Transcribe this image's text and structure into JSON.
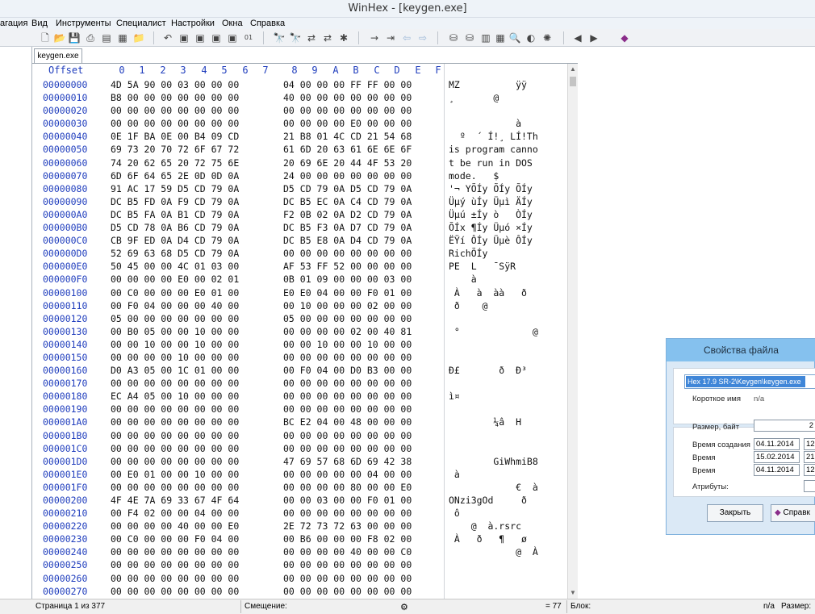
{
  "window": {
    "title": "WinHex - [keygen.exe]"
  },
  "menu": [
    "агация",
    "Вид",
    "Инструменты",
    "Специалист",
    "Настройки",
    "Окна",
    "Справка"
  ],
  "toolbar_icons": [
    "new-file-icon",
    "open-icon",
    "save-icon",
    "print-icon",
    "properties-icon",
    "copy-icon",
    "open-folder-icon",
    "undo-icon",
    "cut-icon",
    "copy-block-icon",
    "paste-icon",
    "paste-special-icon",
    "hex-convert-icon",
    "find-text-icon",
    "find-hex-icon",
    "replace-text-icon",
    "replace-hex-icon",
    "find-next-icon",
    "goto-offset-icon",
    "goto-icon",
    "back-icon",
    "forward-icon",
    "disk-icon",
    "disk2-icon",
    "ram-icon",
    "calculator-icon",
    "search-icon",
    "navigate-icon",
    "settings-icon",
    "prev-icon",
    "next-icon",
    "help-book-icon"
  ],
  "tab": {
    "label": "keygen.exe"
  },
  "header": {
    "offset_label": "Offset",
    "columns": [
      "0",
      "1",
      "2",
      "3",
      "4",
      "5",
      "6",
      "7",
      "8",
      "9",
      "A",
      "B",
      "C",
      "D",
      "E",
      "F"
    ]
  },
  "rows": [
    {
      "offset": "00000000",
      "hex_lo": "4D 5A 90 00 03 00 00 00",
      "hex_hi": "04 00 00 00 FF FF 00 00",
      "ascii": "MZ          ÿÿ"
    },
    {
      "offset": "00000010",
      "hex_lo": "B8 00 00 00 00 00 00 00",
      "hex_hi": "40 00 00 00 00 00 00 00",
      "ascii": "¸       @"
    },
    {
      "offset": "00000020",
      "hex_lo": "00 00 00 00 00 00 00 00",
      "hex_hi": "00 00 00 00 00 00 00 00",
      "ascii": ""
    },
    {
      "offset": "00000030",
      "hex_lo": "00 00 00 00 00 00 00 00",
      "hex_hi": "00 00 00 00 E0 00 00 00",
      "ascii": "            à"
    },
    {
      "offset": "00000040",
      "hex_lo": "0E 1F BA 0E 00 B4 09 CD",
      "hex_hi": "21 B8 01 4C CD 21 54 68",
      "ascii": "  º  ´ Í!¸ LÍ!Th"
    },
    {
      "offset": "00000050",
      "hex_lo": "69 73 20 70 72 6F 67 72",
      "hex_hi": "61 6D 20 63 61 6E 6E 6F",
      "ascii": "is program canno"
    },
    {
      "offset": "00000060",
      "hex_lo": "74 20 62 65 20 72 75 6E",
      "hex_hi": "20 69 6E 20 44 4F 53 20",
      "ascii": "t be run in DOS "
    },
    {
      "offset": "00000070",
      "hex_lo": "6D 6F 64 65 2E 0D 0D 0A",
      "hex_hi": "24 00 00 00 00 00 00 00",
      "ascii": "mode.   $"
    },
    {
      "offset": "00000080",
      "hex_lo": "91 AC 17 59 D5 CD 79 0A",
      "hex_hi": "D5 CD 79 0A D5 CD 79 0A",
      "ascii": "'¬ YÕÍy ÕÍy ÕÍy"
    },
    {
      "offset": "00000090",
      "hex_lo": "DC B5 FD 0A F9 CD 79 0A",
      "hex_hi": "DC B5 EC 0A C4 CD 79 0A",
      "ascii": "Üµý ùÍy Üµì ÄÍy"
    },
    {
      "offset": "000000A0",
      "hex_lo": "DC B5 FA 0A B1 CD 79 0A",
      "hex_hi": "F2 0B 02 0A D2 CD 79 0A",
      "ascii": "Üµú ±Íy ò   ÒÍy"
    },
    {
      "offset": "000000B0",
      "hex_lo": "D5 CD 78 0A B6 CD 79 0A",
      "hex_hi": "DC B5 F3 0A D7 CD 79 0A",
      "ascii": "ÕÍx ¶Íy Üµó ×Íy"
    },
    {
      "offset": "000000C0",
      "hex_lo": "CB 9F ED 0A D4 CD 79 0A",
      "hex_hi": "DC B5 E8 0A D4 CD 79 0A",
      "ascii": "ËŸí ÔÍy Üµè ÔÍy"
    },
    {
      "offset": "000000D0",
      "hex_lo": "52 69 63 68 D5 CD 79 0A",
      "hex_hi": "00 00 00 00 00 00 00 00",
      "ascii": "RichÕÍy"
    },
    {
      "offset": "000000E0",
      "hex_lo": "50 45 00 00 4C 01 03 00",
      "hex_hi": "AF 53 FF 52 00 00 00 00",
      "ascii": "PE  L   ¯SÿR"
    },
    {
      "offset": "000000F0",
      "hex_lo": "00 00 00 00 E0 00 02 01",
      "hex_hi": "0B 01 09 00 00 00 03 00",
      "ascii": "    à"
    },
    {
      "offset": "00000100",
      "hex_lo": "00 C0 00 00 00 E0 01 00",
      "hex_hi": "E0 E0 04 00 00 F0 01 00",
      "ascii": " À   à  àà   ð"
    },
    {
      "offset": "00000110",
      "hex_lo": "00 F0 04 00 00 00 40 00",
      "hex_hi": "00 10 00 00 00 02 00 00",
      "ascii": " ð    @"
    },
    {
      "offset": "00000120",
      "hex_lo": "05 00 00 00 00 00 00 00",
      "hex_hi": "05 00 00 00 00 00 00 00",
      "ascii": ""
    },
    {
      "offset": "00000130",
      "hex_lo": "00 B0 05 00 00 10 00 00",
      "hex_hi": "00 00 00 00 02 00 40 81",
      "ascii": " °             @"
    },
    {
      "offset": "00000140",
      "hex_lo": "00 00 10 00 00 10 00 00",
      "hex_hi": "00 00 10 00 00 10 00 00",
      "ascii": ""
    },
    {
      "offset": "00000150",
      "hex_lo": "00 00 00 00 10 00 00 00",
      "hex_hi": "00 00 00 00 00 00 00 00",
      "ascii": ""
    },
    {
      "offset": "00000160",
      "hex_lo": "D0 A3 05 00 1C 01 00 00",
      "hex_hi": "00 F0 04 00 D0 B3 00 00",
      "ascii": "Ð£       ð  Ð³"
    },
    {
      "offset": "00000170",
      "hex_lo": "00 00 00 00 00 00 00 00",
      "hex_hi": "00 00 00 00 00 00 00 00",
      "ascii": ""
    },
    {
      "offset": "00000180",
      "hex_lo": "EC A4 05 00 10 00 00 00",
      "hex_hi": "00 00 00 00 00 00 00 00",
      "ascii": "ì¤"
    },
    {
      "offset": "00000190",
      "hex_lo": "00 00 00 00 00 00 00 00",
      "hex_hi": "00 00 00 00 00 00 00 00",
      "ascii": ""
    },
    {
      "offset": "000001A0",
      "hex_lo": "00 00 00 00 00 00 00 00",
      "hex_hi": "BC E2 04 00 48 00 00 00",
      "ascii": "        ¼â  H"
    },
    {
      "offset": "000001B0",
      "hex_lo": "00 00 00 00 00 00 00 00",
      "hex_hi": "00 00 00 00 00 00 00 00",
      "ascii": ""
    },
    {
      "offset": "000001C0",
      "hex_lo": "00 00 00 00 00 00 00 00",
      "hex_hi": "00 00 00 00 00 00 00 00",
      "ascii": ""
    },
    {
      "offset": "000001D0",
      "hex_lo": "00 00 00 00 00 00 00 00",
      "hex_hi": "47 69 57 68 6D 69 42 38",
      "ascii": "        GiWhmiB8"
    },
    {
      "offset": "000001E0",
      "hex_lo": "00 E0 01 00 00 10 00 00",
      "hex_hi": "00 00 00 00 00 04 00 00",
      "ascii": " à"
    },
    {
      "offset": "000001F0",
      "hex_lo": "00 00 00 00 00 00 00 00",
      "hex_hi": "00 00 00 00 80 00 00 E0",
      "ascii": "            €  à"
    },
    {
      "offset": "00000200",
      "hex_lo": "4F 4E 7A 69 33 67 4F 64",
      "hex_hi": "00 00 03 00 00 F0 01 00",
      "ascii": "ONzi3gOd     ð"
    },
    {
      "offset": "00000210",
      "hex_lo": "00 F4 02 00 00 04 00 00",
      "hex_hi": "00 00 00 00 00 00 00 00",
      "ascii": " ô"
    },
    {
      "offset": "00000220",
      "hex_lo": "00 00 00 00 40 00 00 E0",
      "hex_hi": "2E 72 73 72 63 00 00 00",
      "ascii": "    @  à.rsrc"
    },
    {
      "offset": "00000230",
      "hex_lo": "00 C0 00 00 00 F0 04 00",
      "hex_hi": "00 B6 00 00 00 F8 02 00",
      "ascii": " À   ð   ¶   ø"
    },
    {
      "offset": "00000240",
      "hex_lo": "00 00 00 00 00 00 00 00",
      "hex_hi": "00 00 00 00 40 00 00 C0",
      "ascii": "            @  À"
    },
    {
      "offset": "00000250",
      "hex_lo": "00 00 00 00 00 00 00 00",
      "hex_hi": "00 00 00 00 00 00 00 00",
      "ascii": ""
    },
    {
      "offset": "00000260",
      "hex_lo": "00 00 00 00 00 00 00 00",
      "hex_hi": "00 00 00 00 00 00 00 00",
      "ascii": ""
    },
    {
      "offset": "00000270",
      "hex_lo": "00 00 00 00 00 00 00 00",
      "hex_hi": "00 00 00 00 00 00 00 00",
      "ascii": ""
    }
  ],
  "status": {
    "page": "Страница 1 из 377",
    "offset_label": "Смещение:",
    "value": "= 77",
    "block_label": "Блок:",
    "na": "n/a",
    "size_label": "Размер:"
  },
  "dialog": {
    "title": "Свойства файла",
    "path": "Hex 17.9 SR-2\\Keygen\\keygen.exe",
    "short_name_label": "Короткое имя",
    "short_name_value": "n/a",
    "size_label": "Размер, байт",
    "size_value": "2",
    "created_label": "Время создания",
    "created_date": "04.11.2014",
    "created_time": "12",
    "time1_label": "Время",
    "time1_date": "15.02.2014",
    "time1_time": "21",
    "time2_label": "Время",
    "time2_date": "04.11.2014",
    "time2_time": "12",
    "attributes_label": "Атрибуты:",
    "close_button": "Закрыть",
    "help_button": "Справк"
  }
}
